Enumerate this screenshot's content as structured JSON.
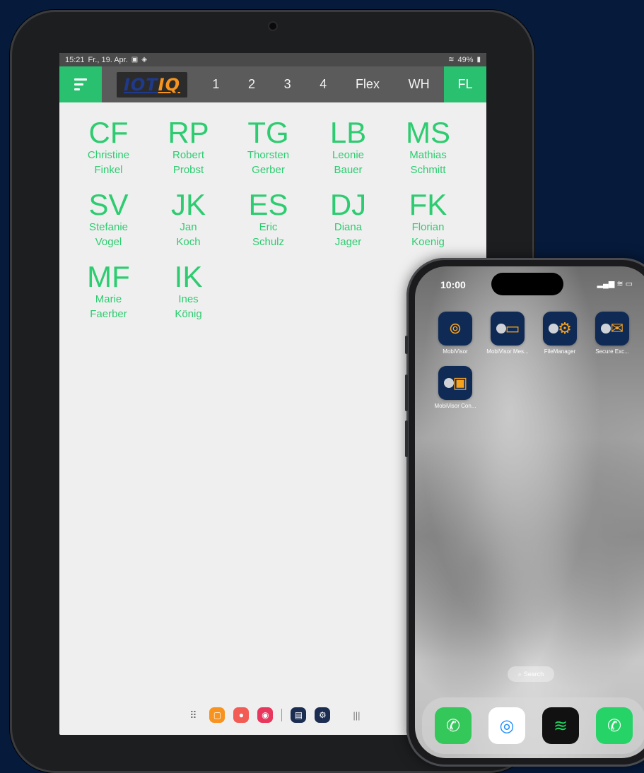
{
  "tablet": {
    "status": {
      "time": "15:21",
      "date": "Fr., 19. Apr.",
      "battery": "49%"
    },
    "logo": {
      "part1": "IOT",
      "part2": "IQ"
    },
    "tabs": [
      "1",
      "2",
      "3",
      "4",
      "Flex",
      "WH"
    ],
    "active_tab": "FL",
    "people": [
      {
        "initials": "CF",
        "first": "Christine",
        "last": "Finkel"
      },
      {
        "initials": "RP",
        "first": "Robert",
        "last": "Probst"
      },
      {
        "initials": "TG",
        "first": "Thorsten",
        "last": "Gerber"
      },
      {
        "initials": "LB",
        "first": "Leonie",
        "last": "Bauer"
      },
      {
        "initials": "MS",
        "first": "Mathias",
        "last": "Schmitt"
      },
      {
        "initials": "SV",
        "first": "Stefanie",
        "last": "Vogel"
      },
      {
        "initials": "JK",
        "first": "Jan",
        "last": "Koch"
      },
      {
        "initials": "ES",
        "first": "Eric",
        "last": "Schulz"
      },
      {
        "initials": "DJ",
        "first": "Diana",
        "last": "Jager"
      },
      {
        "initials": "FK",
        "first": "Florian",
        "last": "Koenig"
      },
      {
        "initials": "MF",
        "first": "Marie",
        "last": "Faerber"
      },
      {
        "initials": "IK",
        "first": "Ines",
        "last": "König"
      }
    ],
    "accent": "#29c070",
    "name_color": "#2ecc71"
  },
  "phone": {
    "time": "10:00",
    "apps": [
      {
        "label": "MobiVisor",
        "icon": "fingerprint-icon"
      },
      {
        "label": "MobiVisor Mes...",
        "icon": "message-icon"
      },
      {
        "label": "FileManager",
        "icon": "folder-gear-icon"
      },
      {
        "label": "Secure Exc...",
        "icon": "mail-icon"
      },
      {
        "label": "MobiVisor Con...",
        "icon": "contacts-icon"
      }
    ],
    "search": "Search",
    "dock": [
      "phone-icon",
      "safari-icon",
      "spotify-icon",
      "whatsapp-icon"
    ]
  }
}
